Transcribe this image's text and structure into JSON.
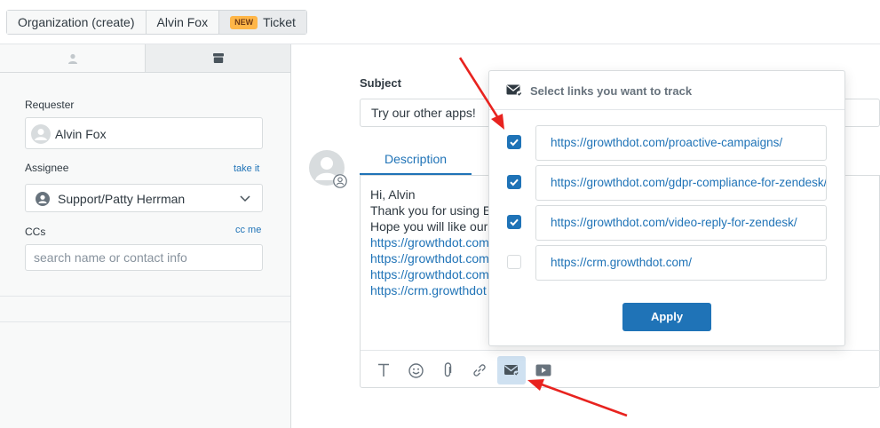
{
  "breadcrumb": {
    "items": [
      {
        "label": "Organization (create)"
      },
      {
        "label": "Alvin Fox"
      },
      {
        "badge": "NEW",
        "label": "Ticket"
      }
    ]
  },
  "sidebar": {
    "tabs": [
      {
        "icon": "user-icon"
      },
      {
        "icon": "briefcase-icon"
      }
    ],
    "requester": {
      "label": "Requester",
      "value": "Alvin Fox"
    },
    "assignee": {
      "label": "Assignee",
      "link": "take it",
      "value": "Support/Patty Herrman"
    },
    "ccs": {
      "label": "CCs",
      "link": "cc me",
      "placeholder": "search name or contact info"
    }
  },
  "main": {
    "subject_label": "Subject",
    "subject_value": "Try our other apps!",
    "description_tab": "Description",
    "body_lines": [
      {
        "text": "Hi, Alvin",
        "link": false
      },
      {
        "text": "Thank you for using E",
        "link": false
      },
      {
        "text": "Hope you will like our",
        "link": false
      },
      {
        "text": "https://growthdot.com",
        "link": true
      },
      {
        "text": "https://growthdot.com",
        "link": true
      },
      {
        "text": "https://growthdot.com",
        "link": true
      },
      {
        "text": "https://crm.growthdot",
        "link": true
      }
    ],
    "toolbar": [
      {
        "icon": "text-format-icon"
      },
      {
        "icon": "emoji-icon"
      },
      {
        "icon": "attachment-icon"
      },
      {
        "icon": "link-icon"
      },
      {
        "icon": "mail-track-icon",
        "active": true
      },
      {
        "icon": "video-icon"
      }
    ]
  },
  "popup": {
    "title": "Select links you want to track",
    "links": [
      {
        "url": "https://growthdot.com/proactive-campaigns/",
        "checked": true
      },
      {
        "url": "https://growthdot.com/gdpr-compliance-for-zendesk/",
        "checked": true
      },
      {
        "url": "https://growthdot.com/video-reply-for-zendesk/",
        "checked": true
      },
      {
        "url": "https://crm.growthdot.com/",
        "checked": false
      }
    ],
    "apply_label": "Apply"
  },
  "colors": {
    "accent": "#1f73b7",
    "badge": "#ffb648",
    "annotation_arrow": "#e8231f"
  }
}
